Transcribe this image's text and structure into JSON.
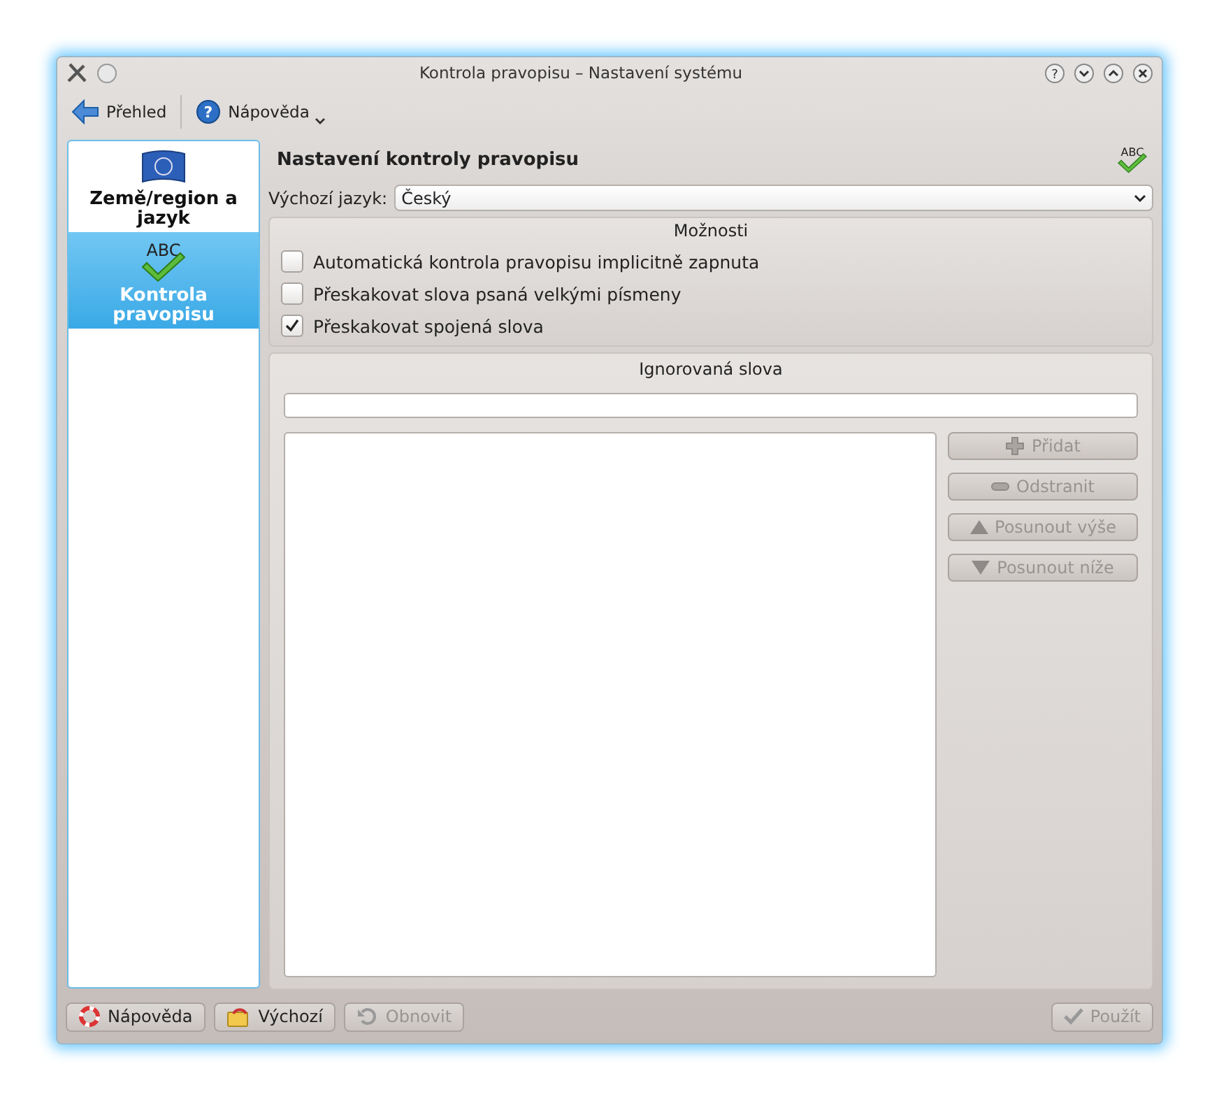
{
  "window": {
    "title": "Kontrola pravopisu – Nastavení systému",
    "help_glyph": "?"
  },
  "toolbar": [
    {
      "label": "Přehled",
      "kind": "back"
    },
    {
      "label": "Nápověda",
      "kind": "help",
      "glyph": "?"
    }
  ],
  "sidebar": {
    "items": [
      {
        "label": "Země/region a jazyk",
        "kind": "flag",
        "selected": false
      },
      {
        "label": "Kontrola pravopisu",
        "kind": "spell",
        "icon_text": "ABC",
        "selected": true
      }
    ]
  },
  "page": {
    "title": "Nastavení kontroly pravopisu",
    "icon_text": "ABC",
    "language_label": "Výchozí jazyk:",
    "language": "Český",
    "options": {
      "title": "Možnosti",
      "items": [
        {
          "label": "Automatická kontrola pravopisu implicitně zapnuta",
          "checked": false
        },
        {
          "label": "Přeskakovat slova psaná velkými písmeny",
          "checked": false
        },
        {
          "label": "Přeskakovat spojená slova",
          "checked": true
        }
      ]
    },
    "ignored": {
      "title": "Ignorovaná slova",
      "buttons": [
        {
          "label": "Přidat",
          "kind": "plus",
          "disabled": true
        },
        {
          "label": "Odstranit",
          "kind": "minus",
          "disabled": true
        },
        {
          "label": "Posunout výše",
          "kind": "up",
          "disabled": true
        },
        {
          "label": "Posunout níže",
          "kind": "down",
          "disabled": true
        }
      ]
    }
  },
  "buttons": [
    {
      "label": "Nápověda",
      "kind": "help",
      "disabled": false
    },
    {
      "label": "Výchozí",
      "kind": "default",
      "disabled": false
    },
    {
      "label": "Obnovit",
      "kind": "reset",
      "disabled": true
    },
    {
      "label": "Použít",
      "kind": "apply",
      "disabled": true
    }
  ]
}
